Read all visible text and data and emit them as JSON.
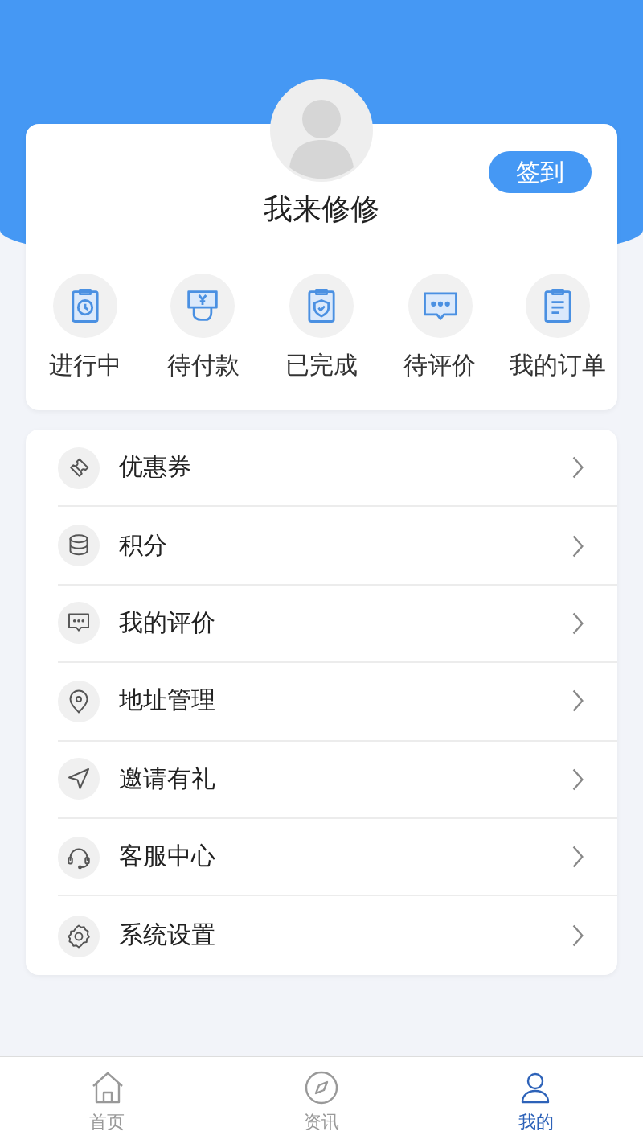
{
  "profile": {
    "name": "我来修修",
    "sign_in": "签到"
  },
  "orders": [
    {
      "label": "进行中",
      "kind": "clock"
    },
    {
      "label": "待付款",
      "kind": "pay"
    },
    {
      "label": "已完成",
      "kind": "shield"
    },
    {
      "label": "待评价",
      "kind": "chat"
    },
    {
      "label": "我的订单",
      "kind": "doc"
    }
  ],
  "menu": [
    {
      "label": "优惠券",
      "kind": "ticket"
    },
    {
      "label": "积分",
      "kind": "coins"
    },
    {
      "label": "我的评价",
      "kind": "chat"
    },
    {
      "label": "地址管理",
      "kind": "pin"
    },
    {
      "label": "邀请有礼",
      "kind": "send"
    },
    {
      "label": "客服中心",
      "kind": "headset"
    },
    {
      "label": "系统设置",
      "kind": "gear"
    }
  ],
  "tab_bar": [
    {
      "label": "首页",
      "kind": "home",
      "selected": false
    },
    {
      "label": "资讯",
      "kind": "compass",
      "selected": false
    },
    {
      "label": "我的",
      "kind": "person",
      "selected": true
    }
  ]
}
